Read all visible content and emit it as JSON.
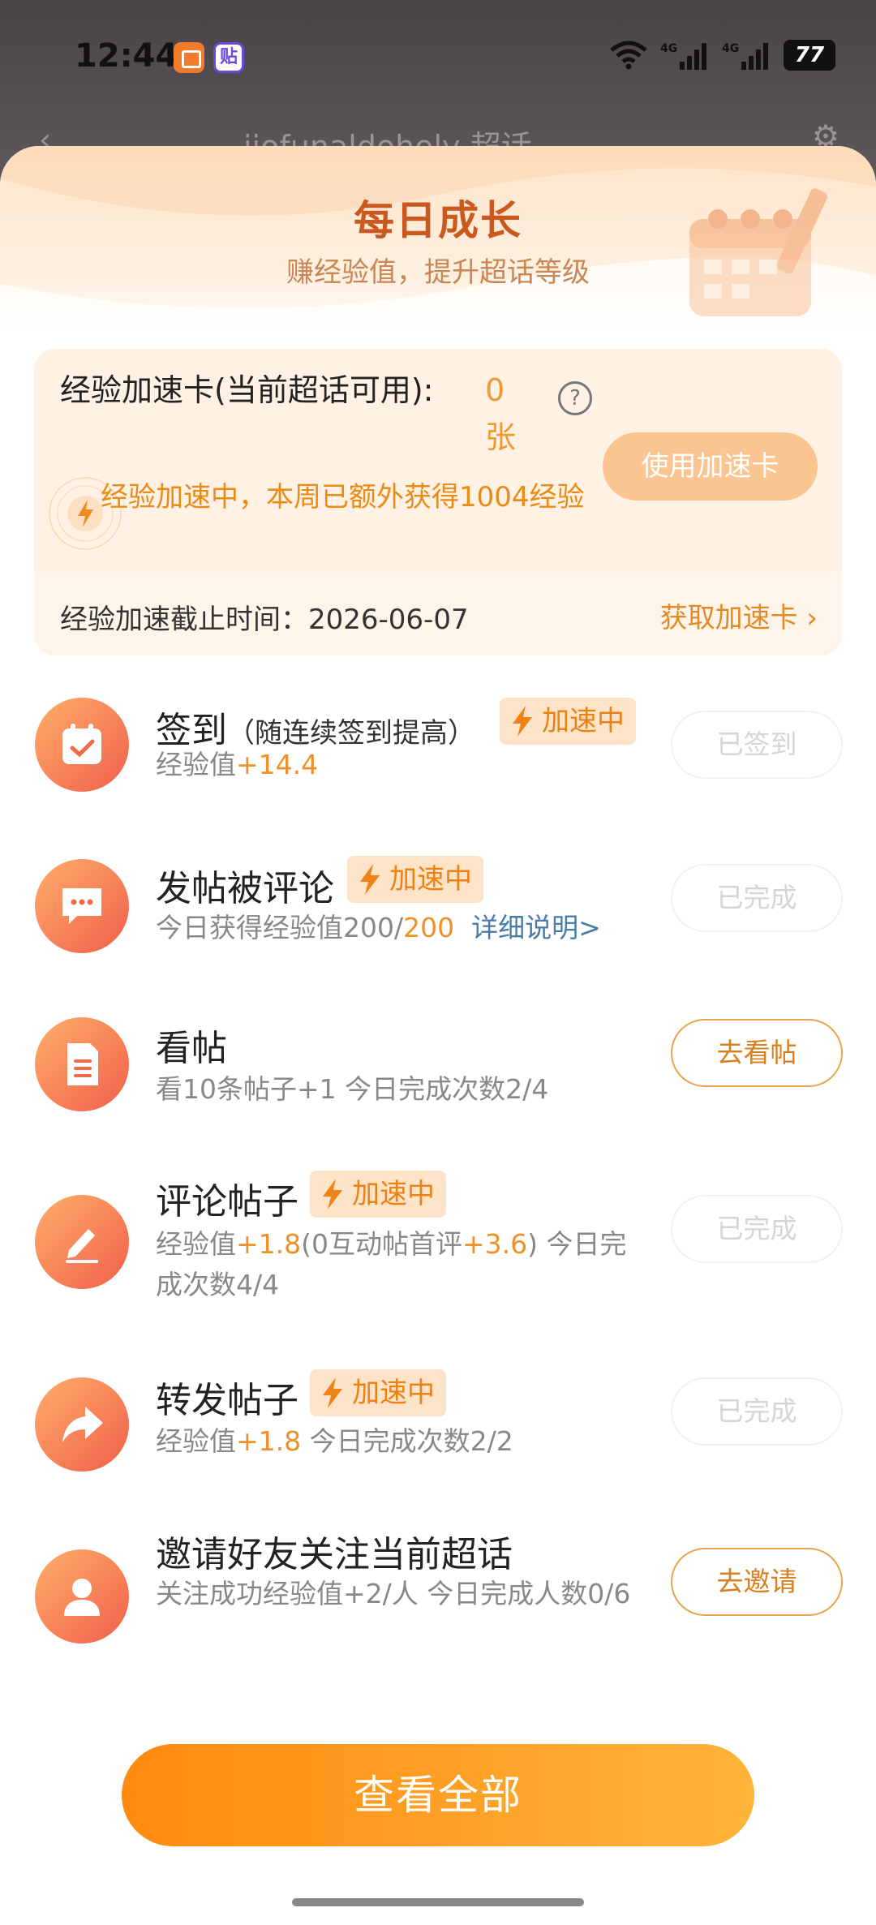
{
  "status_bar": {
    "time": "12:44",
    "app2_glyph": "贴",
    "battery": "77",
    "icons": [
      "wifi-icon",
      "signal-4g-icon",
      "signal-4g-icon"
    ]
  },
  "behind": {
    "title": "jiofunaldoholy 超话"
  },
  "header": {
    "title": "每日成长",
    "subtitle": "赚经验值，提升超话等级"
  },
  "accel_card": {
    "label": "经验加速卡(当前超话可用):",
    "count": "0 张",
    "use_button": "使用加速卡",
    "status": "经验加速中，本周已额外获得1004经验",
    "deadline_label": "经验加速截止时间：",
    "deadline_date": "2026-06-07",
    "get_link": "获取加速卡"
  },
  "badge_label": "加速中",
  "tasks": [
    {
      "title": "签到",
      "title_note": "（随连续签到提高）",
      "desc_prefix": "经验值",
      "desc_hl": "+14.4",
      "button": "已签到",
      "icon": "calendar-check-icon"
    },
    {
      "title": "发帖被评论",
      "desc_prefix": "今日获得经验值200/",
      "desc_hl": "200",
      "desc_link": "详细说明>",
      "button": "已完成",
      "icon": "comment-bubble-icon"
    },
    {
      "title": "看帖",
      "desc": "看10条帖子+1   今日完成次数2/4",
      "button": "去看帖",
      "icon": "document-icon"
    },
    {
      "title": "评论帖子",
      "desc_a": "经验值",
      "desc_b": "+1.8",
      "desc_c": "(0互动帖首评",
      "desc_d": "+3.6",
      "desc_e": ")   今日完成次数4/4",
      "button": "已完成",
      "icon": "edit-pen-icon"
    },
    {
      "title": "转发帖子",
      "desc_prefix": "经验值",
      "desc_hl": "+1.8",
      "desc_suffix": "   今日完成次数2/2",
      "button": "已完成",
      "icon": "share-arrow-icon"
    },
    {
      "title": "邀请好友关注当前超话",
      "desc": "关注成功经验值+2/人   今日完成人数0/6",
      "button": "去邀请",
      "icon": "user-icon"
    }
  ],
  "footer": {
    "view_all": "查看全部"
  }
}
